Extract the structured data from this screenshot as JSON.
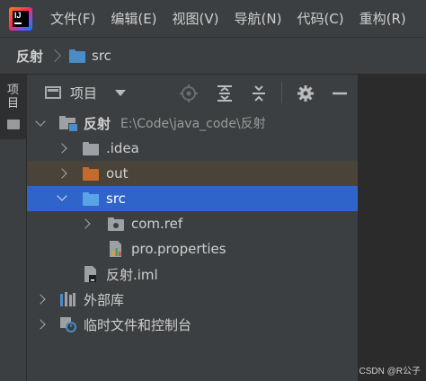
{
  "menubar": {
    "items": [
      "文件(F)",
      "编辑(E)",
      "视图(V)",
      "导航(N)",
      "代码(C)",
      "重构(R)"
    ]
  },
  "breadcrumb": {
    "project": "反射",
    "folder": "src"
  },
  "side_strip": {
    "tab_label": "项目"
  },
  "toolbar": {
    "view_label": "项目"
  },
  "tree": {
    "root_name": "反射",
    "root_path": "E:\\Code\\java_code\\反射",
    "idea": ".idea",
    "out": "out",
    "src": "src",
    "package": "com.ref",
    "properties": "pro.properties",
    "iml": "反射.iml",
    "external_libs": "外部库",
    "scratches": "临时文件和控制台"
  },
  "colors": {
    "selection": "#2f65ca",
    "excluded_row": "#4a433a",
    "src_folder": "#4a8cc7",
    "excluded_folder": "#c46a2d",
    "plain_folder": "#9da1a5"
  },
  "watermark": "CSDN @R公子"
}
